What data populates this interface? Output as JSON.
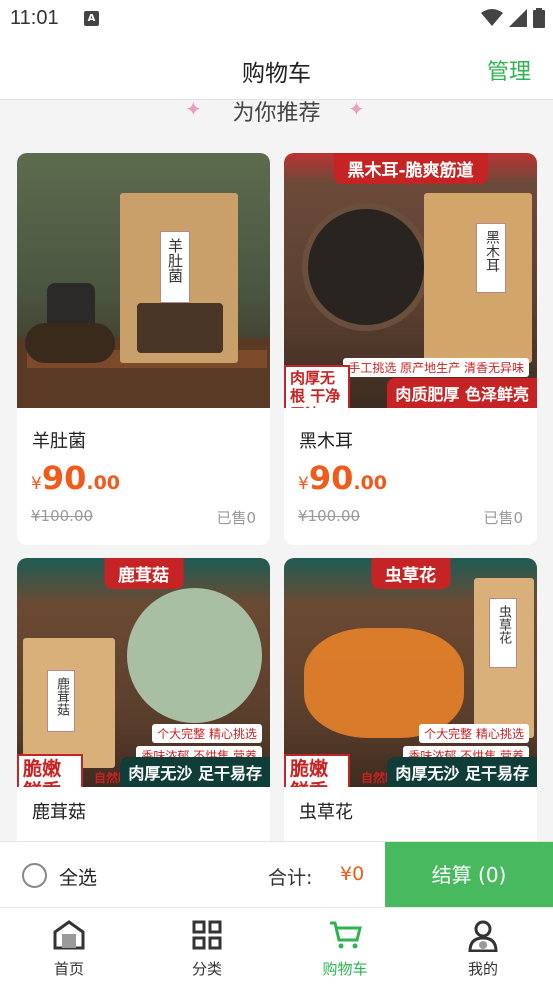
{
  "status": {
    "time": "11:01",
    "notice_letter": "A"
  },
  "header": {
    "title": "购物车",
    "manage_label": "管理"
  },
  "recommend": {
    "title": "为你推荐"
  },
  "products": [
    {
      "name": "羊肚菌",
      "currency": "¥",
      "price_int": "90",
      "price_dec": ".00",
      "original": "¥100.00",
      "sold": "已售0",
      "image_label": "羊肚菌"
    },
    {
      "name": "黑木耳",
      "currency": "¥",
      "price_int": "90",
      "price_dec": ".00",
      "original": "¥100.00",
      "sold": "已售0",
      "image_label": "黑木耳",
      "banner": "黑木耳-脆爽筋道",
      "stamp": "肉厚无根 干净无沙",
      "tag": "肉质肥厚 色泽鲜亮",
      "tag_small": "手工挑选 原产地生产 清香无异味"
    },
    {
      "name": "鹿茸菇",
      "image_label": "鹿茸菇",
      "banner": "鹿茸菇",
      "stamp": "脆嫩 鲜香",
      "tag": "肉厚无沙 足干易存",
      "tag_mid": "自然晾晒 干净无硫",
      "tag_small_1": "个大完整 精心挑选",
      "tag_small_2": "香味浓郁 不烘焦 营养"
    },
    {
      "name": "虫草花",
      "image_label": "虫草花",
      "banner": "虫草花",
      "stamp": "脆嫩 鲜香",
      "tag": "肉厚无沙 足干易存",
      "tag_mid": "自然晾晒 干净无硫",
      "tag_small_1": "个大完整 精心挑选",
      "tag_small_2": "香味浓郁 不烘焦 营养"
    }
  ],
  "checkout": {
    "select_all": "全选",
    "total_label": "合计:",
    "total_value": "¥0",
    "button_label": "结算 (0)"
  },
  "tabs": [
    {
      "label": "首页",
      "icon": "home-icon"
    },
    {
      "label": "分类",
      "icon": "category-icon"
    },
    {
      "label": "购物车",
      "icon": "cart-icon",
      "active": true
    },
    {
      "label": "我的",
      "icon": "profile-icon"
    }
  ],
  "colors": {
    "accent": "#2db451",
    "price": "#f05a1a",
    "checkout": "#48b95e",
    "banner_red": "#c62424"
  }
}
